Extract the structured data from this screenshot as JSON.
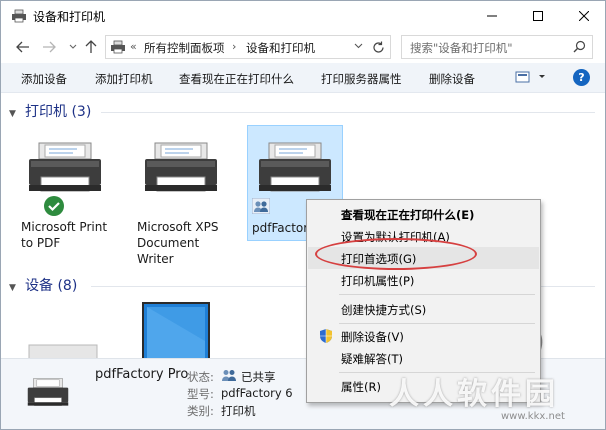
{
  "window": {
    "title": "设备和打印机"
  },
  "address": {
    "overflow": "«",
    "crumbs": [
      "所有控制面板项",
      "设备和打印机"
    ],
    "separator": "›"
  },
  "search": {
    "placeholder": "搜索\"设备和打印机\""
  },
  "commands": [
    "添加设备",
    "添加打印机",
    "查看现在正在打印什么",
    "打印服务器属性",
    "删除设备"
  ],
  "help_label": "?",
  "sections": {
    "printers": {
      "title": "打印机 (3)"
    },
    "devices": {
      "title": "设备 (8)"
    }
  },
  "printers": [
    {
      "label": "Microsoft Print to PDF",
      "default": true
    },
    {
      "label": "Microsoft XPS Document Writer",
      "default": false
    },
    {
      "label": "pdfFactory Pro",
      "shared": true,
      "selected": true
    }
  ],
  "context_menu": {
    "items": [
      {
        "label": "查看现在正在打印什么(E)",
        "bold": true
      },
      {
        "label": "设置为默认打印机(A)"
      },
      {
        "label": "打印首选项(G)",
        "highlighted": true
      },
      {
        "label": "打印机属性(P)"
      },
      {
        "label": "创建快捷方式(S)"
      },
      {
        "label": "删除设备(V)",
        "icon": "uac-shield-icon"
      },
      {
        "label": "疑难解答(T)"
      },
      {
        "label": "属性(R)"
      }
    ]
  },
  "details": {
    "name": "pdfFactory Pro",
    "status_key": "状态:",
    "status_value": "已共享",
    "model_key": "型号:",
    "model_value": "pdfFactory 6",
    "category_key": "类别:",
    "category_value": "打印机"
  },
  "watermark": {
    "text": "人人软件园",
    "url": "www.kkx.net"
  },
  "colors": {
    "accent": "#1e3287",
    "selection": "#cce8ff",
    "command_bar": "#f0f4f9",
    "default_check": "#2e8b3e",
    "annotation": "#d64040"
  }
}
